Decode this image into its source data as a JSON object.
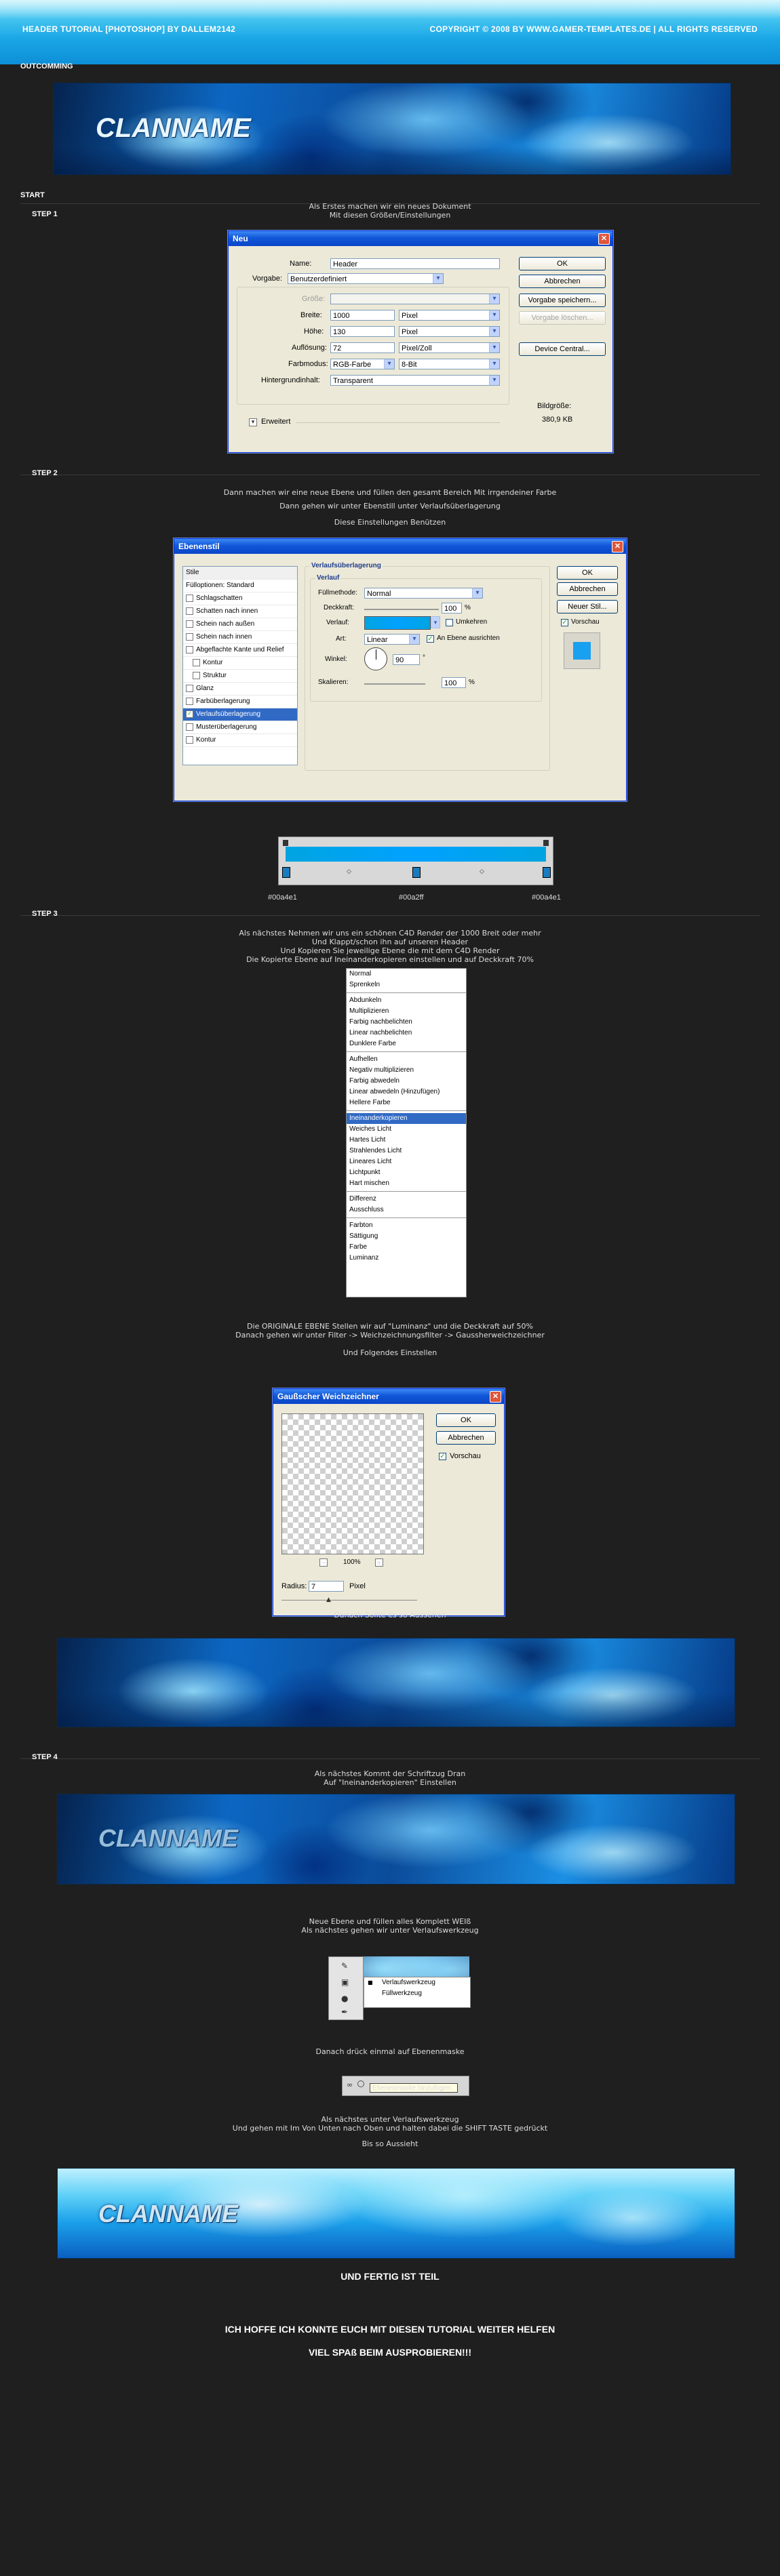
{
  "header": {
    "left": "HEADER TUTORIAL [PHOTOSHOP] BY DALLEM2142",
    "right": "COPYRIGHT © 2008 BY WWW.GAMER-TEMPLATES.DE  |  ALL RIGHTS RESERVED"
  },
  "outcomming": {
    "label": "OUTCOMMING",
    "banner_text": "CLANNAME"
  },
  "start": {
    "label": "START"
  },
  "step1": {
    "label": "STEP 1",
    "text": [
      "Als Erstes machen wir ein neues Dokument",
      "Mit diesen Größen/Einstellungen"
    ],
    "dialog": {
      "title": "Neu",
      "name_label": "Name:",
      "name_value": "Header",
      "preset_label": "Vorgabe:",
      "preset_value": "Benutzerdefiniert",
      "size_label": "Größe:",
      "width_label": "Breite:",
      "width_value": "1000",
      "width_unit": "Pixel",
      "height_label": "Höhe:",
      "height_value": "130",
      "height_unit": "Pixel",
      "res_label": "Auflösung:",
      "res_value": "72",
      "res_unit": "Pixel/Zoll",
      "mode_label": "Farbmodus:",
      "mode_value": "RGB-Farbe",
      "mode_bits": "8-Bit",
      "bg_label": "Hintergrundinhalt:",
      "bg_value": "Transparent",
      "advanced": "Erweitert",
      "buttons": [
        "OK",
        "Abbrechen",
        "Vorgabe speichern...",
        "Vorgabe löschen...",
        "Device Central..."
      ],
      "imgsize_label": "Bildgröße:",
      "imgsize_value": "380,9 KB"
    }
  },
  "step2": {
    "label": "STEP 2",
    "text": [
      "Dann machen wir eine neue Ebene und füllen den gesamt Bereich Mit irrgendeiner Farbe",
      "Dann gehen wir unter Ebenstill unter Verlaufsüberlagerung",
      "",
      "Diese Einstellungen Benützen"
    ],
    "dialog": {
      "title": "Ebenenstil",
      "styles_header": "Stile",
      "blend_options": "Fülloptionen: Standard",
      "items": [
        "Schlagschatten",
        "Schatten nach innen",
        "Schein nach außen",
        "Schein nach innen",
        "Abgeflachte Kante und Relief",
        "Kontur",
        "Struktur",
        "Glanz",
        "Farbüberlagerung",
        "Verlaufsüberlagerung",
        "Musterüberlagerung",
        "Kontur"
      ],
      "section_title": "Verlaufsüberlagerung",
      "subsection": "Verlauf",
      "blend_mode_label": "Füllmethode:",
      "blend_mode_value": "Normal",
      "opacity_label": "Deckkraft:",
      "opacity_value": "100",
      "percent": "%",
      "gradient_label": "Verlauf:",
      "reverse_label": "Umkehren",
      "style_label": "Art:",
      "style_value": "Linear",
      "align_label": "An Ebene ausrichten",
      "angle_label": "Winkel:",
      "angle_value": "90",
      "degree": "°",
      "scale_label": "Skalieren:",
      "scale_value": "100",
      "buttons": [
        "OK",
        "Abbrechen",
        "Neuer Stil...",
        "Vorschau"
      ]
    },
    "gradient": {
      "colors": [
        "#00a4e1",
        "#00a2ff",
        "#00a4e1"
      ],
      "labels": [
        "#00a4e1",
        "#00a2ff",
        "#00a4e1"
      ]
    }
  },
  "step3": {
    "label": "STEP 3",
    "text": [
      "Als nächstes Nehmen wir uns ein schönen C4D Render der 1000 Breit oder mehr",
      "Und Klappt/schon ihn auf unseren Header",
      "Und Kopieren Sie jeweilige Ebene die mit dem C4D Render",
      "Die Kopierte Ebene auf Ineinanderkopieren einstellen und auf Deckkraft 70%"
    ],
    "menu": [
      "Normal",
      "Sprenkeln",
      "-",
      "Abdunkeln",
      "Multiplizieren",
      "Farbig nachbelichten",
      "Linear nachbelichten",
      "Dunklere Farbe",
      "-",
      "Aufhellen",
      "Negativ multiplizieren",
      "Farbig abwedeln",
      "Linear abwedeln (Hinzufügen)",
      "Hellere Farbe",
      "-",
      "Ineinanderkopieren",
      "Weiches Licht",
      "Hartes Licht",
      "Strahlendes Licht",
      "Lineares Licht",
      "Lichtpunkt",
      "Hart mischen",
      "-",
      "Differenz",
      "Ausschluss",
      "-",
      "Farbton",
      "Sättigung",
      "Farbe",
      "Luminanz"
    ],
    "menu_selected": "Ineinanderkopieren",
    "text2": [
      "Die ORIGINALE EBENE Stellen wir auf \"Luminanz\" und die Deckkraft auf 50%",
      "Danach gehen wir unter Filter -> Weichzeichnungsfilter -> Gaussherweichzeichner",
      "",
      "Und Folgendes Einstellen"
    ],
    "gauss": {
      "title": "Gaußscher Weichzeichner",
      "buttons": [
        "OK",
        "Abbrechen"
      ],
      "preview_label": "Vorschau",
      "zoom": "100%",
      "minus": "−",
      "plus": "+",
      "radius_label": "Radius:",
      "radius_value": "7",
      "radius_unit": "Pixel"
    },
    "after": "Danach Sollte es so Aussehen"
  },
  "step4": {
    "label": "STEP 4",
    "text": [
      "Als nächstes Kommt der Schriftzug Dran",
      "Auf \"Ineinanderkopieren\" Einstellen"
    ],
    "banner_text": "CLANNAME",
    "text2": [
      "Neue Ebene und füllen alles Komplett WEIß",
      "Als nächstes gehen wir unter Verlaufswerkzeug"
    ],
    "tools": [
      "Verlaufswerkzeug",
      "Füllwerkzeug"
    ],
    "text3": "Danach drück einmal auf Ebenenmaske",
    "mask_label": "Ebenenmaske hinzufügen",
    "text4": [
      "Als nächstes unter Verlaufswerkzeug",
      "Und gehen mit Im Von Unten nach Oben und halten dabei die SHIFT TASTE gedrückt"
    ],
    "text5": "Bis so Aussieht",
    "banner3_text": "CLANNAME"
  },
  "ending": {
    "line1": "UND FERTIG IST TEIL",
    "line2": "ICH HOFFE ICH KONNTE EUCH MIT DIESEN TUTORIAL WEITER HELFEN",
    "line3": "VIEL SPAß BEIM AUSPROBIEREN!!!"
  }
}
